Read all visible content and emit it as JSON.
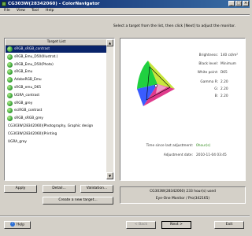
{
  "window": {
    "title": "CG303W(28342060) - ColorNavigator"
  },
  "menu": [
    "File",
    "View",
    "Tool",
    "Help"
  ],
  "instruction": "Select a target from the list, then click [Next] to adjust the monitor.",
  "target_list": {
    "header": "Target List",
    "items": [
      {
        "label": "sRGB_sRGB_contrast",
        "icon": "green-ball-icon",
        "selected": true
      },
      {
        "label": "sRGB_Emu_D50(Illustrat.)",
        "icon": "green-ball-icon"
      },
      {
        "label": "sRGB_Emu_D50(Photo)",
        "icon": "green-ball-icon"
      },
      {
        "label": "sRGB_Emu",
        "icon": "green-ball-icon"
      },
      {
        "label": "AdobeRGB_Emu",
        "icon": "green-ball-icon"
      },
      {
        "label": "sRGB_emu_D65",
        "icon": "green-ball-icon"
      },
      {
        "label": "UGRA_contrast",
        "icon": "green-ball-icon"
      },
      {
        "label": "sRGB_grey",
        "icon": "green-ball-icon"
      },
      {
        "label": "eciRGB_contrast",
        "icon": "green-ball-icon"
      },
      {
        "label": "sRGB_sRGB_grey",
        "icon": "green-ball-icon"
      },
      {
        "label": "CG303W(28342060)(Photography, Graphic design",
        "icon": ""
      },
      {
        "label": "CG303W(28342060)(Printing",
        "icon": ""
      },
      {
        "label": "UGRA_grey",
        "icon": ""
      }
    ]
  },
  "buttons": {
    "apply": "Apply",
    "detail": "Detail...",
    "validation": "Validation...",
    "create_target": "Create a new target...",
    "help": "Help",
    "back": "< Back",
    "next": "Next >",
    "exit": "Exit"
  },
  "target_info": {
    "brightness_label": "Brightness:",
    "brightness_value": "140 cd/m²",
    "black_level_label": "Black level:",
    "black_level_value": "Minimum",
    "white_point_label": "White point:",
    "white_point_value": "D65",
    "gamma_label": "Gamma R:",
    "gamma_r": "2.20",
    "gamma_g_label": "G:",
    "gamma_g": "2.20",
    "gamma_b_label": "B:",
    "gamma_b": "2.20",
    "time_since_label": "Time since last adjustment:",
    "time_since_value": "0hour(s)",
    "adjust_date_label": "Adjustment date:",
    "adjust_date_value": "2010-11-04 03:45"
  },
  "status": {
    "usage_line": "CG303W(28342060) 233 hour(s) used",
    "sensor_line": "Eye-One Monitor / Pro(342165)"
  },
  "colors": {
    "selection": "#0a246a",
    "value_green": "#2f8a1a"
  }
}
